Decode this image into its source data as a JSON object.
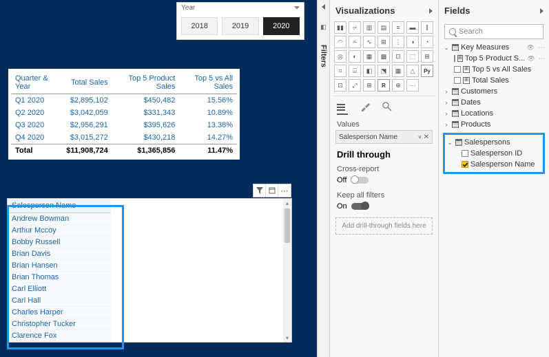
{
  "slicer": {
    "title": "Year",
    "options": [
      "2018",
      "2019",
      "2020"
    ],
    "selected": "2020"
  },
  "table": {
    "headers": [
      "Quarter & Year",
      "Total Sales",
      "Top 5 Product Sales",
      "Top 5 vs All Sales"
    ],
    "rows": [
      {
        "qy": "Q1 2020",
        "total": "$2,895,102",
        "top5": "$450,482",
        "pct": "15.56%"
      },
      {
        "qy": "Q2 2020",
        "total": "$3,042,059",
        "top5": "$331,343",
        "pct": "10.89%"
      },
      {
        "qy": "Q3 2020",
        "total": "$2,956,291",
        "top5": "$395,626",
        "pct": "13.38%"
      },
      {
        "qy": "Q4 2020",
        "total": "$3,015,272",
        "top5": "$430,218",
        "pct": "14.27%"
      }
    ],
    "total_row": {
      "qy": "Total",
      "total": "$11,908,724",
      "top5": "$1,365,856",
      "pct": "11.47%"
    }
  },
  "sp_list": {
    "header": "Salesperson Name",
    "rows": [
      "Andrew Bowman",
      "Arthur Mccoy",
      "Bobby Russell",
      "Brian Davis",
      "Brian Hansen",
      "Brian Thomas",
      "Carl Elliott",
      "Carl Hall",
      "Charles Harper",
      "Christopher Tucker",
      "Clarence Fox"
    ]
  },
  "filters_label": "Filters",
  "viz_pane": {
    "title": "Visualizations",
    "values_label": "Values",
    "value_field": "Salesperson Name",
    "drill_header": "Drill through",
    "cross_label": "Cross-report",
    "cross_state": "Off",
    "keep_label": "Keep all filters",
    "keep_state": "On",
    "drop_hint": "Add drill-through fields here",
    "py_label": "Py",
    "r_label": "R"
  },
  "fields_pane": {
    "title": "Fields",
    "search_placeholder": "Search",
    "key_measures": {
      "label": "Key Measures",
      "items": [
        {
          "label": "Top 5 Product S...",
          "checked": false,
          "hover": true
        },
        {
          "label": "Top 5 vs All Sales",
          "checked": false
        },
        {
          "label": "Total Sales",
          "checked": false
        }
      ]
    },
    "tables": [
      "Customers",
      "Dates",
      "Locations",
      "Products"
    ],
    "salespersons": {
      "label": "Salespersons",
      "fields": [
        {
          "label": "Salesperson ID",
          "checked": false
        },
        {
          "label": "Salesperson Name",
          "checked": true
        }
      ]
    }
  }
}
